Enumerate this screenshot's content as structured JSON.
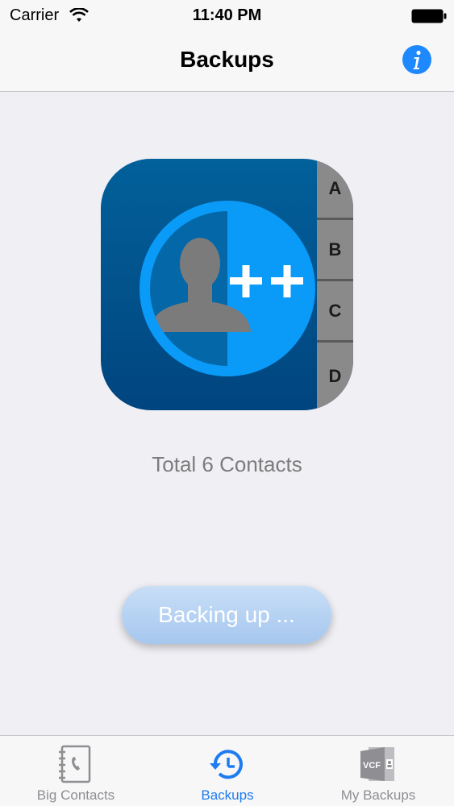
{
  "status_bar": {
    "carrier": "Carrier",
    "time": "11:40 PM",
    "wifi_icon": "wifi-icon",
    "battery_icon": "battery-icon"
  },
  "nav_bar": {
    "title": "Backups",
    "info_icon": "info-icon",
    "accent_color": "#1e88ff"
  },
  "app_icon": {
    "tab_letters": [
      "A",
      "B",
      "C",
      "D"
    ],
    "badge_text": "++"
  },
  "total_contacts": "Total 6 Contacts",
  "backup_button": {
    "label": "Backing up ..."
  },
  "tab_bar": {
    "items": [
      {
        "label": "Big Contacts",
        "icon": "address-book-icon",
        "active": false
      },
      {
        "label": "Backups",
        "icon": "backup-history-icon",
        "active": true
      },
      {
        "label": "My Backups",
        "icon": "vcf-file-icon",
        "active": false
      }
    ],
    "vcf_text": "VCF"
  },
  "colors": {
    "active_tab": "#1e7cf0",
    "inactive_tab": "#8e8e93",
    "background": "#efeff4"
  }
}
